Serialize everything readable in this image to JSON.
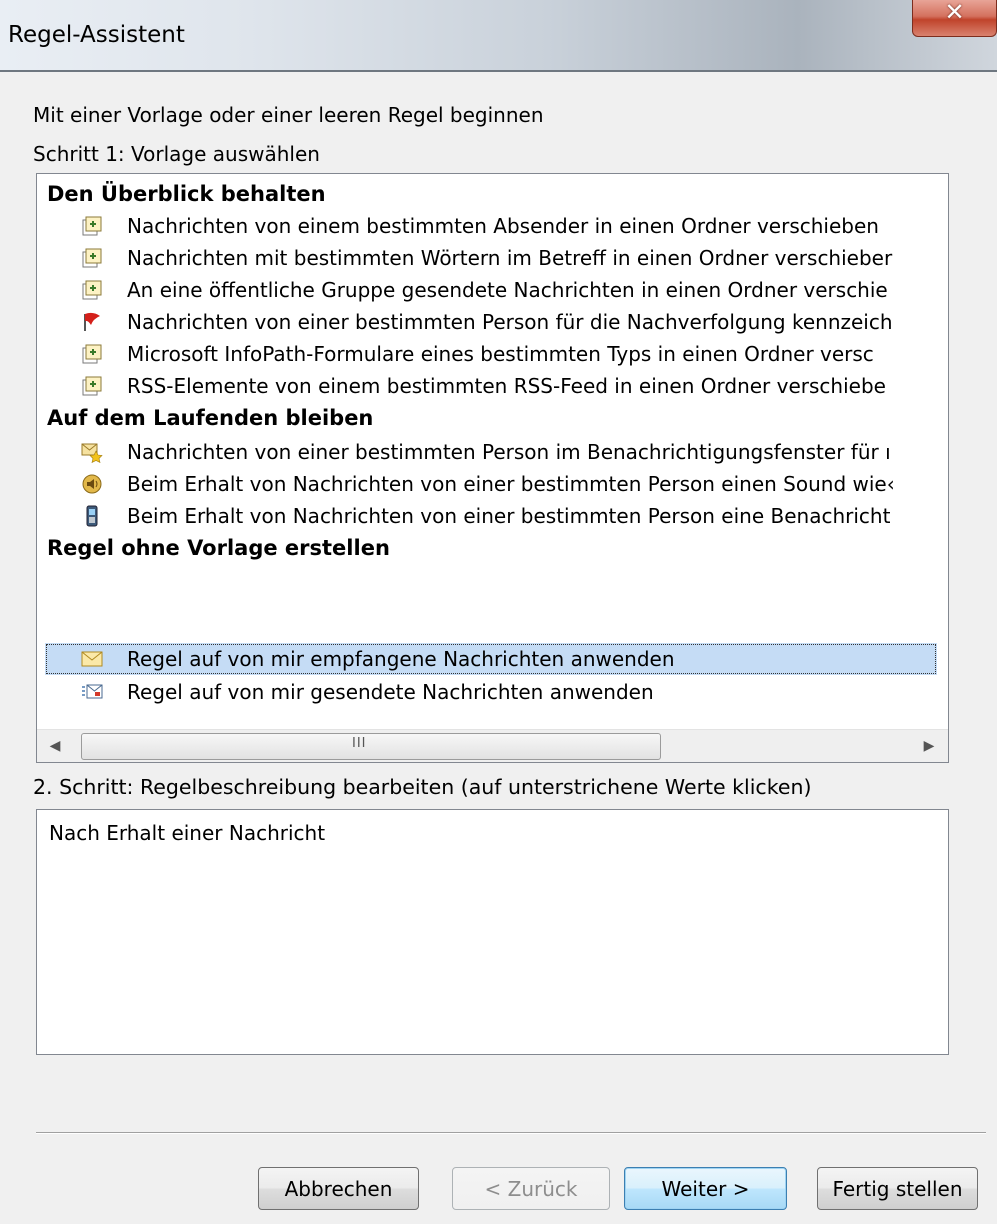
{
  "window": {
    "title": "Regel-Assistent"
  },
  "step1": {
    "intro": "Mit einer Vorlage oder einer leeren Regel beginnen",
    "label": "Schritt 1: Vorlage auswählen",
    "groups": [
      {
        "title": "Den Überblick behalten",
        "items": [
          {
            "icon": "move-to-folder-icon",
            "label": "Nachrichten von einem bestimmten Absender in einen Ordner verschieben"
          },
          {
            "icon": "move-to-folder-icon",
            "label": "Nachrichten mit bestimmten Wörtern im Betreff in einen Ordner verschieber"
          },
          {
            "icon": "move-to-folder-icon",
            "label": "An eine öffentliche Gruppe gesendete Nachrichten in einen Ordner verschie"
          },
          {
            "icon": "flag-icon",
            "label": "Nachrichten von einer bestimmten Person für die Nachverfolgung kennzeich"
          },
          {
            "icon": "move-to-folder-icon",
            "label": "Microsoft InfoPath-Formulare eines bestimmten Typs in einen Ordner versc"
          },
          {
            "icon": "move-to-folder-icon",
            "label": "RSS-Elemente von einem bestimmten RSS-Feed in einen Ordner verschiebe"
          }
        ]
      },
      {
        "title": "Auf dem Laufenden bleiben",
        "items": [
          {
            "icon": "new-mail-alert-icon",
            "label": "Nachrichten von einer bestimmten Person im Benachrichtigungsfenster für ı"
          },
          {
            "icon": "sound-icon",
            "label": "Beim Erhalt von Nachrichten von einer bestimmten Person einen Sound wie‹"
          },
          {
            "icon": "mobile-device-icon",
            "label": "Beim Erhalt von Nachrichten von einer bestimmten Person eine Benachricht"
          }
        ]
      },
      {
        "title": "Regel ohne Vorlage erstellen",
        "items": [
          {
            "icon": "envelope-icon",
            "label": "Regel auf von mir empfangene Nachrichten anwenden",
            "selected": true
          },
          {
            "icon": "sent-message-icon",
            "label": "Regel auf von mir gesendete Nachrichten anwenden"
          }
        ]
      }
    ],
    "scrollbar": {
      "grip": "III"
    }
  },
  "step2": {
    "label": "2. Schritt: Regelbeschreibung bearbeiten (auf unterstrichene Werte klicken)",
    "description": "Nach Erhalt einer Nachricht"
  },
  "buttons": {
    "cancel": "Abbrechen",
    "back": "< Zurück",
    "next": "Weiter >",
    "finish": "Fertig stellen"
  },
  "colors": {
    "selection": "#c5dcf5",
    "default_button_border": "#3c7fb1",
    "close_button": "#c0432b"
  }
}
